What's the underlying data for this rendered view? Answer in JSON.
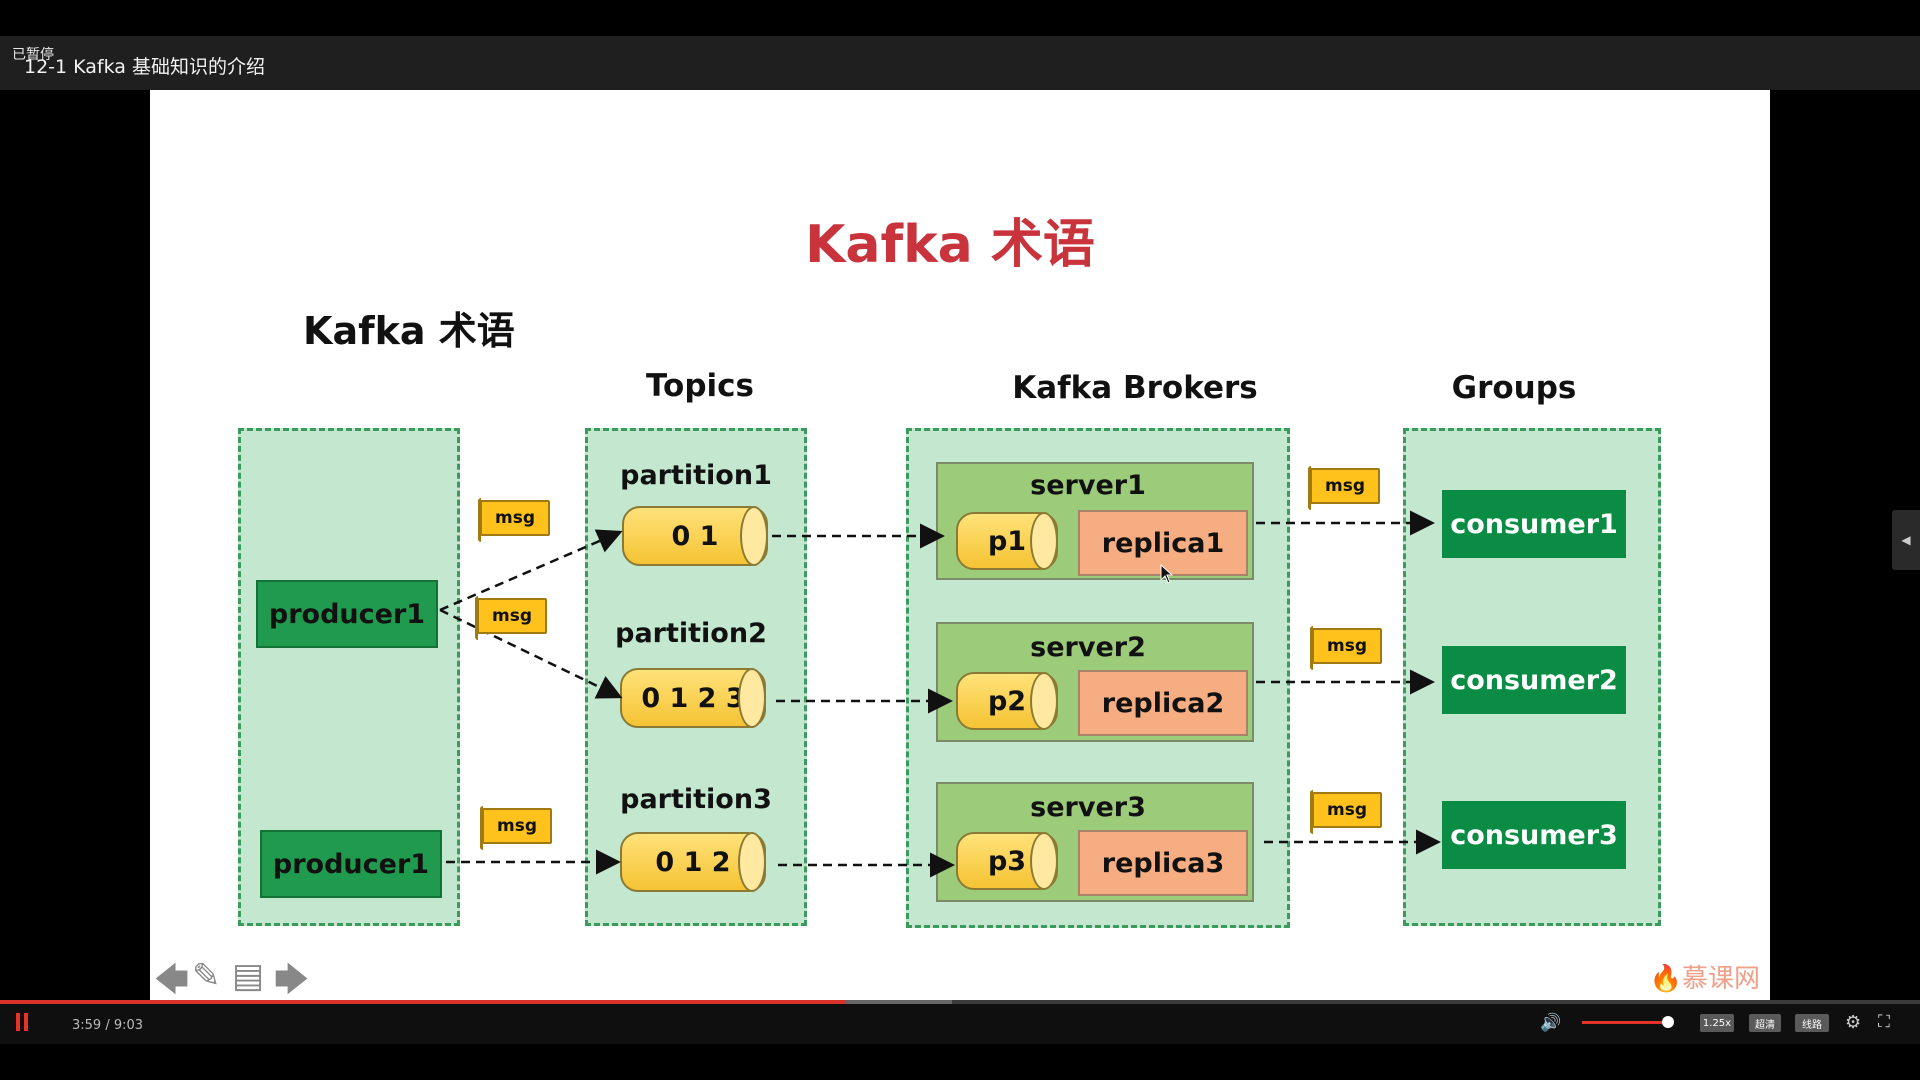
{
  "player": {
    "status_text": "已暂停",
    "title": "12-1 Kafka 基础知识的介绍",
    "time": "3:59 / 9:03",
    "progress": 0.44,
    "speed": "1.25x",
    "quality": "超清",
    "line": "线路"
  },
  "slide": {
    "main_title": "Kafka 术语",
    "sub_title": "Kafka 术语",
    "headings": {
      "topics": "Topics",
      "brokers": "Kafka Brokers",
      "groups": "Groups"
    },
    "producers": [
      "producer1",
      "producer1"
    ],
    "msg_label": "msg",
    "partitions": [
      {
        "label": "partition1",
        "content": "0 1"
      },
      {
        "label": "partition2",
        "content": "0 1 2 3"
      },
      {
        "label": "partition3",
        "content": "0 1 2"
      }
    ],
    "servers": [
      {
        "label": "server1",
        "p": "p1",
        "replica": "replica1"
      },
      {
        "label": "server2",
        "p": "p2",
        "replica": "replica2"
      },
      {
        "label": "server3",
        "p": "p3",
        "replica": "replica3"
      }
    ],
    "consumers": [
      "consumer1",
      "consumer2",
      "consumer3"
    ],
    "logo": "慕课网"
  },
  "colors": {
    "title": "#c8333c",
    "accent": "#e5332a"
  }
}
